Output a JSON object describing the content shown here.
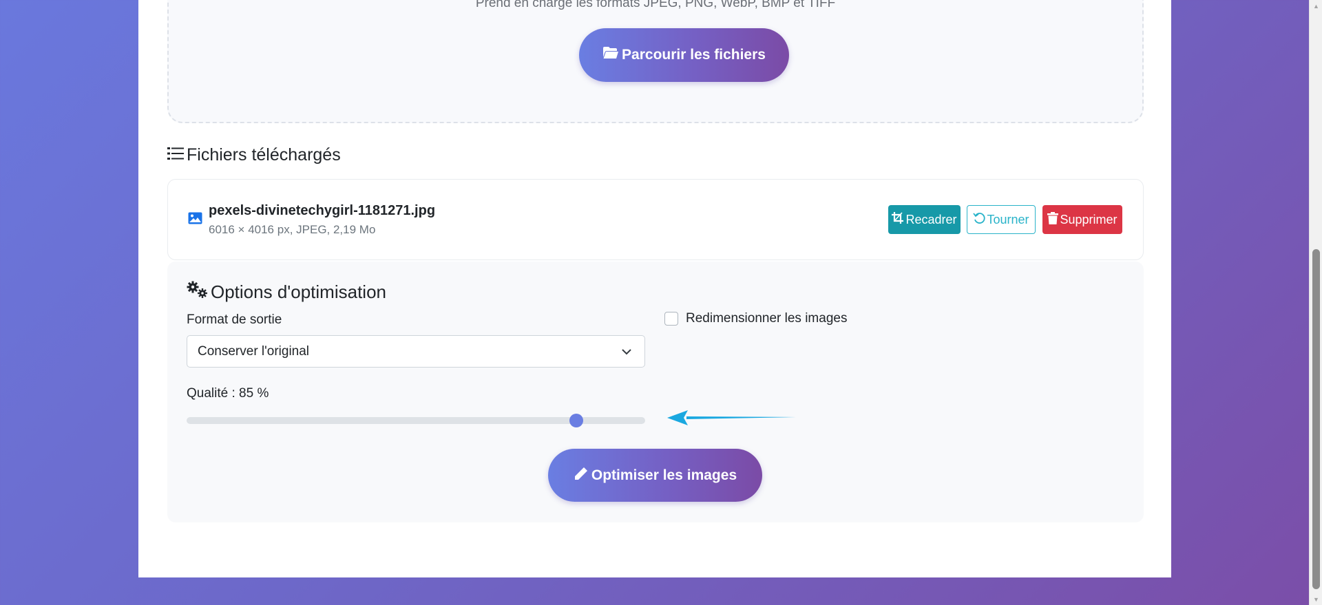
{
  "dropzone": {
    "hint": "Prend en charge les formats JPEG, PNG, WebP, BMP et TIFF",
    "browse_label": "Parcourir les fichiers"
  },
  "uploaded": {
    "title": "Fichiers téléchargés",
    "file": {
      "name": "pexels-divinetechygirl-1181271.jpg",
      "meta": "6016 × 4016 px, JPEG, 2,19 Mo"
    },
    "actions": {
      "crop": "Recadrer",
      "rotate": "Tourner",
      "delete": "Supprimer"
    }
  },
  "options": {
    "title": "Options d'optimisation",
    "format_label": "Format de sortie",
    "format_value": "Conserver l'original",
    "resize_label": "Redimensionner les images",
    "resize_checked": false,
    "quality_label": "Qualité : 85 %",
    "quality_value": 85,
    "optimize_label": "Optimiser les images"
  },
  "colors": {
    "accent": "#6a7ee2",
    "crop": "#1799a8",
    "rotate": "#29b3c9",
    "delete": "#dc3545",
    "annotation_arrow": "#1aa8e0"
  },
  "icons": {
    "browse": "folder-open-icon",
    "list": "list-icon",
    "file": "image-icon",
    "crop": "crop-icon",
    "rotate": "rotate-icon",
    "delete": "trash-icon",
    "options": "gears-icon",
    "optimize": "pencil-icon"
  }
}
